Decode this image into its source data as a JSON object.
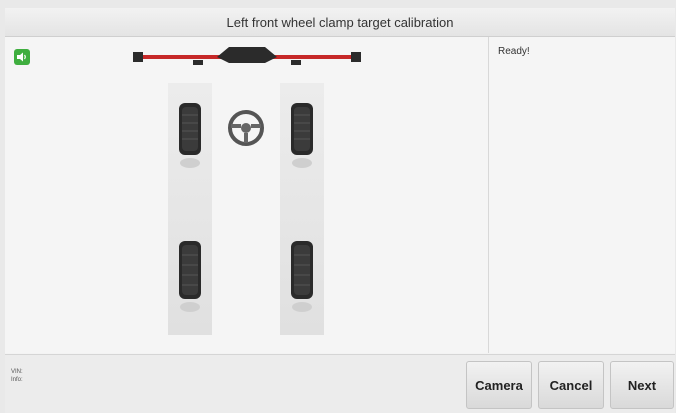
{
  "header": {
    "title": "Left front wheel clamp target calibration"
  },
  "status": {
    "message": "Ready!"
  },
  "footer": {
    "vin_label": "VIN:",
    "info_label": "Info:",
    "buttons": {
      "camera": "Camera",
      "cancel": "Cancel",
      "next": "Next"
    }
  },
  "icons": {
    "sound": "speaker-icon",
    "steering": "steering-wheel-icon",
    "tire": "tire-icon",
    "clamp_target": "clamp-target-beam-icon"
  },
  "colors": {
    "accent_green": "#3fae3f",
    "beam_red": "#c62828"
  }
}
